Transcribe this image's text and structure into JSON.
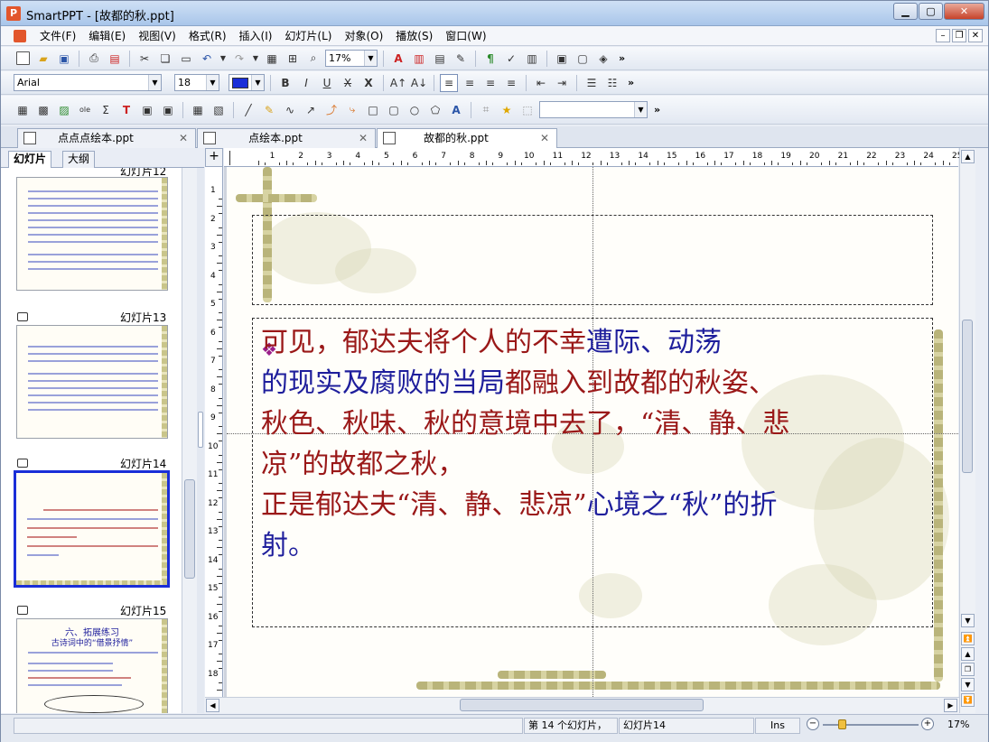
{
  "window": {
    "title": "SmartPPT - [故都的秋.ppt]"
  },
  "menus": [
    "文件(F)",
    "编辑(E)",
    "视图(V)",
    "格式(R)",
    "插入(I)",
    "幻灯片(L)",
    "对象(O)",
    "播放(S)",
    "窗口(W)"
  ],
  "toolbar": {
    "zoom": "17%",
    "font": "Arial",
    "font_size": "18",
    "more": "»"
  },
  "tabs": [
    {
      "label": "点点点绘本.ppt"
    },
    {
      "label": "点绘本.ppt"
    },
    {
      "label": "故都的秋.ppt",
      "active": true
    }
  ],
  "left_tabs": [
    "幻灯片",
    "大纲"
  ],
  "slides": [
    {
      "label": "幻灯片12"
    },
    {
      "label": "幻灯片13"
    },
    {
      "label": "幻灯片14",
      "selected": true
    },
    {
      "label": "幻灯片15",
      "title": "六、拓展练习",
      "subtitle": "古诗词中的“借景抒情”"
    }
  ],
  "slide_content": {
    "lines": [
      [
        {
          "t": "    可见，",
          "c": "red"
        },
        {
          "t": "郁达夫将个人的",
          "c": "red"
        },
        {
          "t": "不幸",
          "c": "red"
        },
        {
          "t": "遭际、",
          "c": "blue"
        },
        {
          "t": "动荡",
          "c": "blue"
        }
      ],
      [
        {
          "t": "的现实及",
          "c": "blue"
        },
        {
          "t": "腐败",
          "c": "blue"
        },
        {
          "t": "的当局",
          "c": "blue"
        },
        {
          "t": "都融入到故都的秋姿、",
          "c": "red"
        }
      ],
      [
        {
          "t": "秋色、秋味、秋的意境中去了，“清、静、悲",
          "c": "red"
        }
      ],
      [
        {
          "t": "凉”的故都之秋，",
          "c": "red"
        }
      ],
      [
        {
          "t": "正是郁达夫“清、静、悲凉”",
          "c": "red"
        },
        {
          "t": "心境之“秋”的折",
          "c": "blue"
        }
      ],
      [
        {
          "t": "射。",
          "c": "blue"
        }
      ]
    ]
  },
  "ruler": {
    "h": [
      "1",
      "1",
      "2",
      "3",
      "4",
      "5",
      "6",
      "7",
      "8",
      "9",
      "10",
      "11",
      "12",
      "13",
      "14",
      "15",
      "16",
      "17",
      "18",
      "19",
      "20",
      "21",
      "22",
      "23",
      "24",
      "25"
    ],
    "v": [
      "1",
      "2",
      "3",
      "4",
      "5",
      "6",
      "7",
      "8",
      "9",
      "10",
      "11",
      "12",
      "13",
      "14",
      "15",
      "16",
      "17",
      "18"
    ]
  },
  "status": {
    "position": "第 14 个幻灯片，",
    "slide_name": "幻灯片14",
    "mode": "Ins",
    "zoom": "17%"
  },
  "colors": {
    "accent": "#1a2ed8",
    "text_red": "#9a1818",
    "text_blue": "#1e1e9c"
  }
}
